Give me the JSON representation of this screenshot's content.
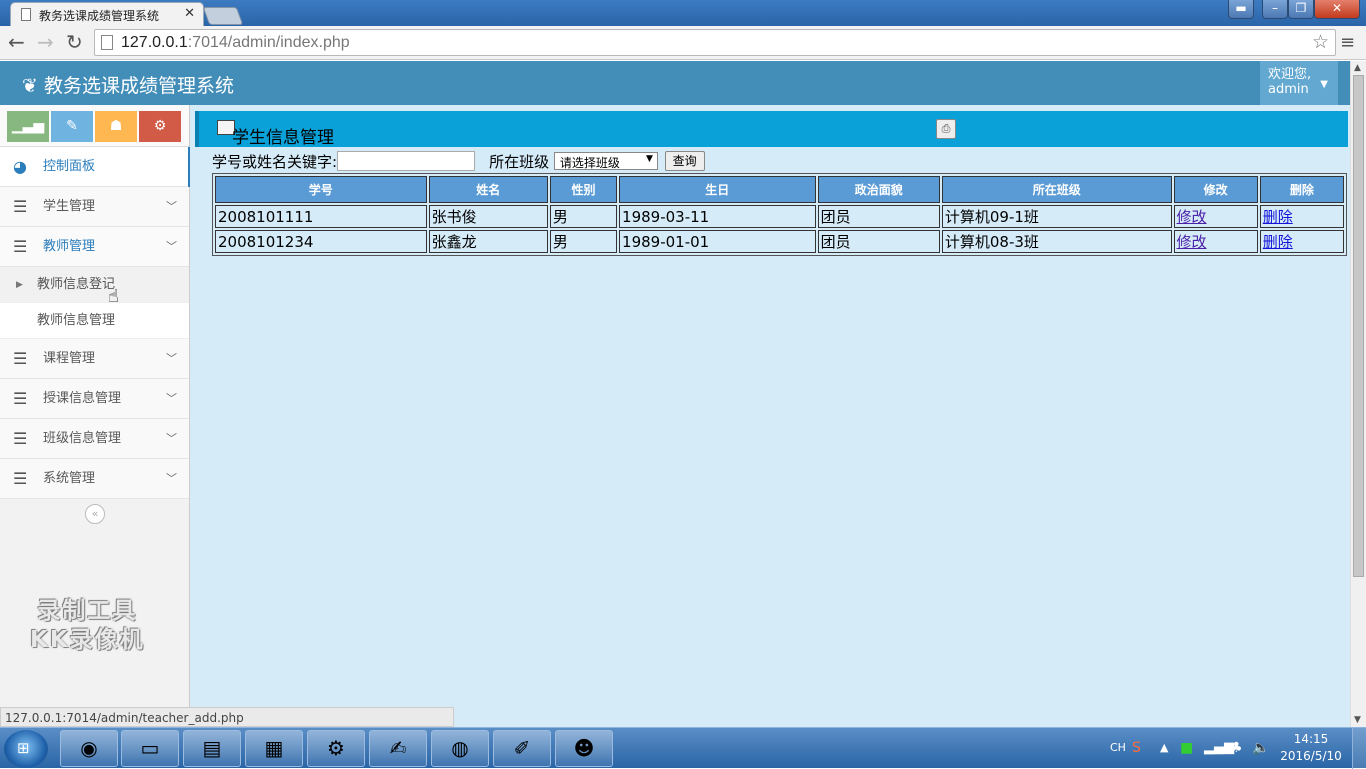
{
  "browser": {
    "tab_title": "教务选课成绩管理系统",
    "url_host": "127.0.0.1",
    "url_rest": ":7014/admin/index.php",
    "status_url": "127.0.0.1:7014/admin/teacher_add.php"
  },
  "header": {
    "app_title": "教务选课成绩管理系统",
    "welcome": "欢迎您,",
    "username": "admin"
  },
  "sidebar": {
    "items": [
      {
        "label": "控制面板",
        "icon": "dashboard-icon"
      },
      {
        "label": "学生管理",
        "icon": "list-icon"
      },
      {
        "label": "教师管理",
        "icon": "list-icon"
      },
      {
        "label": "课程管理",
        "icon": "list-icon"
      },
      {
        "label": "授课信息管理",
        "icon": "list-icon"
      },
      {
        "label": "班级信息管理",
        "icon": "list-icon"
      },
      {
        "label": "系统管理",
        "icon": "list-icon"
      }
    ],
    "subitems": [
      {
        "label": "教师信息登记"
      },
      {
        "label": "教师信息管理"
      }
    ],
    "watermark": [
      "录制工具",
      "KK录像机"
    ]
  },
  "main": {
    "page_title": "学生信息管理",
    "search": {
      "keyword_label": "学号或姓名关键字:",
      "class_label": "所在班级",
      "class_selected": "请选择班级",
      "query_button": "查询"
    },
    "table": {
      "headers": [
        "学号",
        "姓名",
        "性别",
        "生日",
        "政治面貌",
        "所在班级",
        "修改",
        "删除"
      ],
      "rows": [
        [
          "2008101111",
          "张书俊",
          "男",
          "1989-03-11",
          "团员",
          "计算机09-1班",
          "修改",
          "删除"
        ],
        [
          "2008101234",
          "张鑫龙",
          "男",
          "1989-01-01",
          "团员",
          "计算机08-3班",
          "修改",
          "删除"
        ]
      ]
    }
  },
  "taskbar": {
    "lang": "CH",
    "time": "14:15",
    "date": "2016/5/10"
  }
}
